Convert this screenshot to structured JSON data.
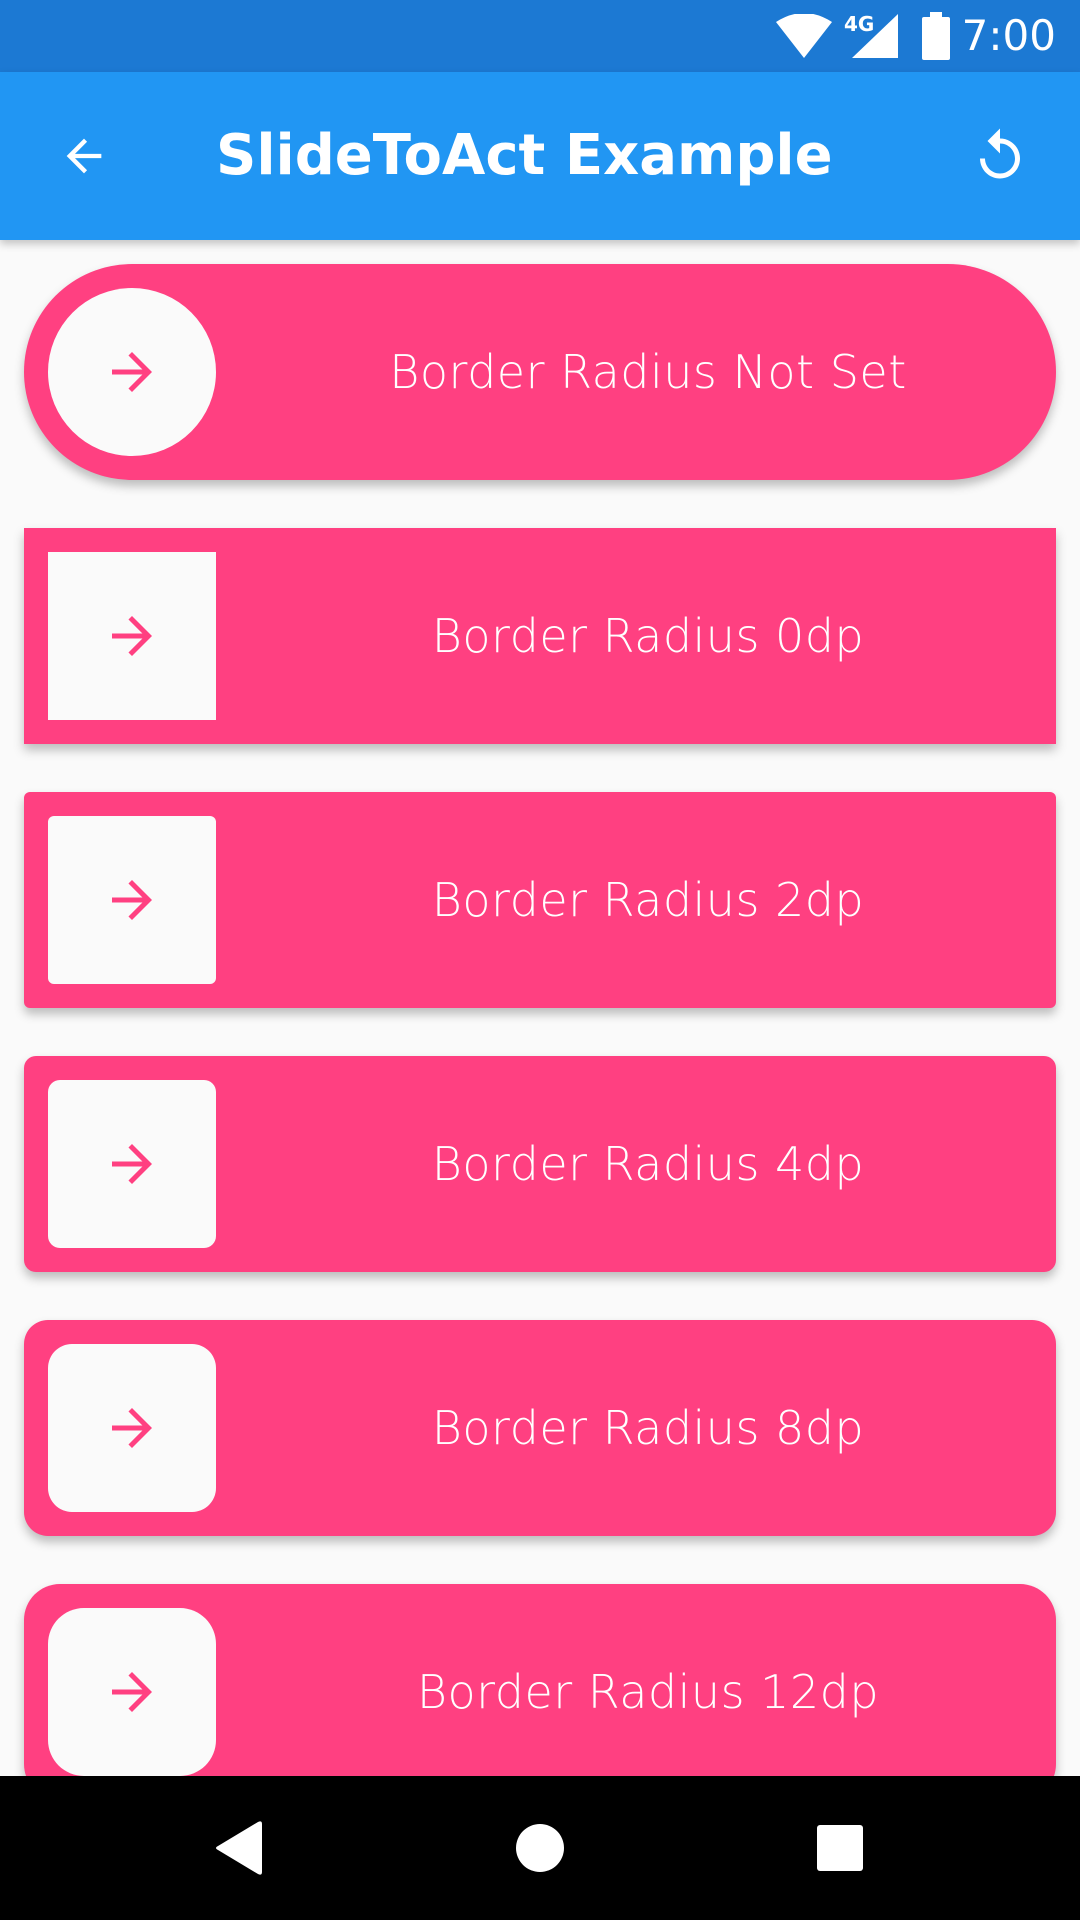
{
  "status_bar": {
    "time": "7:00",
    "network": "4G",
    "icons": [
      "wifi-icon",
      "cellular-signal-icon",
      "battery-icon"
    ]
  },
  "app_bar": {
    "title": "SlideToAct Example",
    "back_icon": "arrow-back-icon",
    "reset_icon": "reset-icon"
  },
  "sliders": [
    {
      "label": "Border Radius Not Set",
      "knob_icon": "arrow-forward-icon"
    },
    {
      "label": "Border Radius 0dp",
      "knob_icon": "arrow-forward-icon"
    },
    {
      "label": "Border Radius 2dp",
      "knob_icon": "arrow-forward-icon"
    },
    {
      "label": "Border Radius 4dp",
      "knob_icon": "arrow-forward-icon"
    },
    {
      "label": "Border Radius 8dp",
      "knob_icon": "arrow-forward-icon"
    },
    {
      "label": "Border Radius 12dp",
      "knob_icon": "arrow-forward-icon"
    }
  ],
  "nav_bar": {
    "buttons": [
      "back-nav-icon",
      "home-nav-icon",
      "recents-nav-icon"
    ]
  },
  "colors": {
    "status_bar": "#1C79D3",
    "app_bar": "#2196F3",
    "slider_outer": "#FF4081",
    "slider_inner": "#FAFAFA",
    "background": "#FAFAFA"
  }
}
